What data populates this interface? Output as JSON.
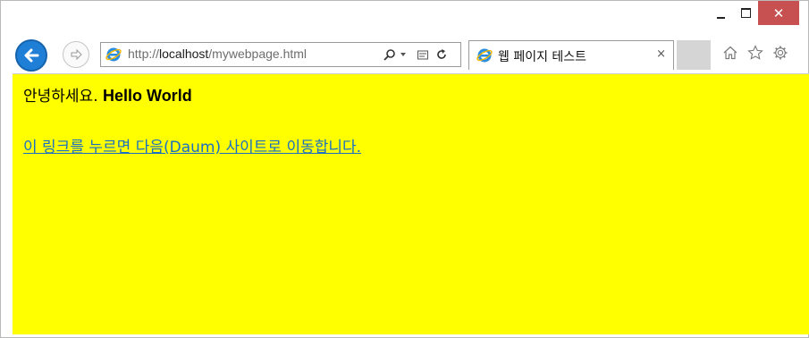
{
  "window": {
    "controls": {
      "minimize": "minimize",
      "maximize": "maximize",
      "close": "✕"
    }
  },
  "navigation": {
    "url_prefix": "http://",
    "url_host": "localhost",
    "url_path": "/mywebpage.html",
    "tab_title": "웹 페이지 테스트",
    "tab_close": "×"
  },
  "page": {
    "greeting_ko": "안녕하세요. ",
    "greeting_en": "Hello World",
    "link_text": "이 링크를 누르면 다음(Daum) 사이트로 이동합니다."
  },
  "icons": [
    "back-arrow-icon",
    "forward-arrow-icon",
    "internet-explorer-icon",
    "search-icon",
    "compatibility-view-icon",
    "refresh-icon",
    "home-icon",
    "favorites-star-icon",
    "settings-gear-icon"
  ],
  "colors": {
    "page_background": "#ffff00",
    "link": "#1a6fc4",
    "close_button": "#c75050",
    "back_button": "#1f7fd6"
  }
}
